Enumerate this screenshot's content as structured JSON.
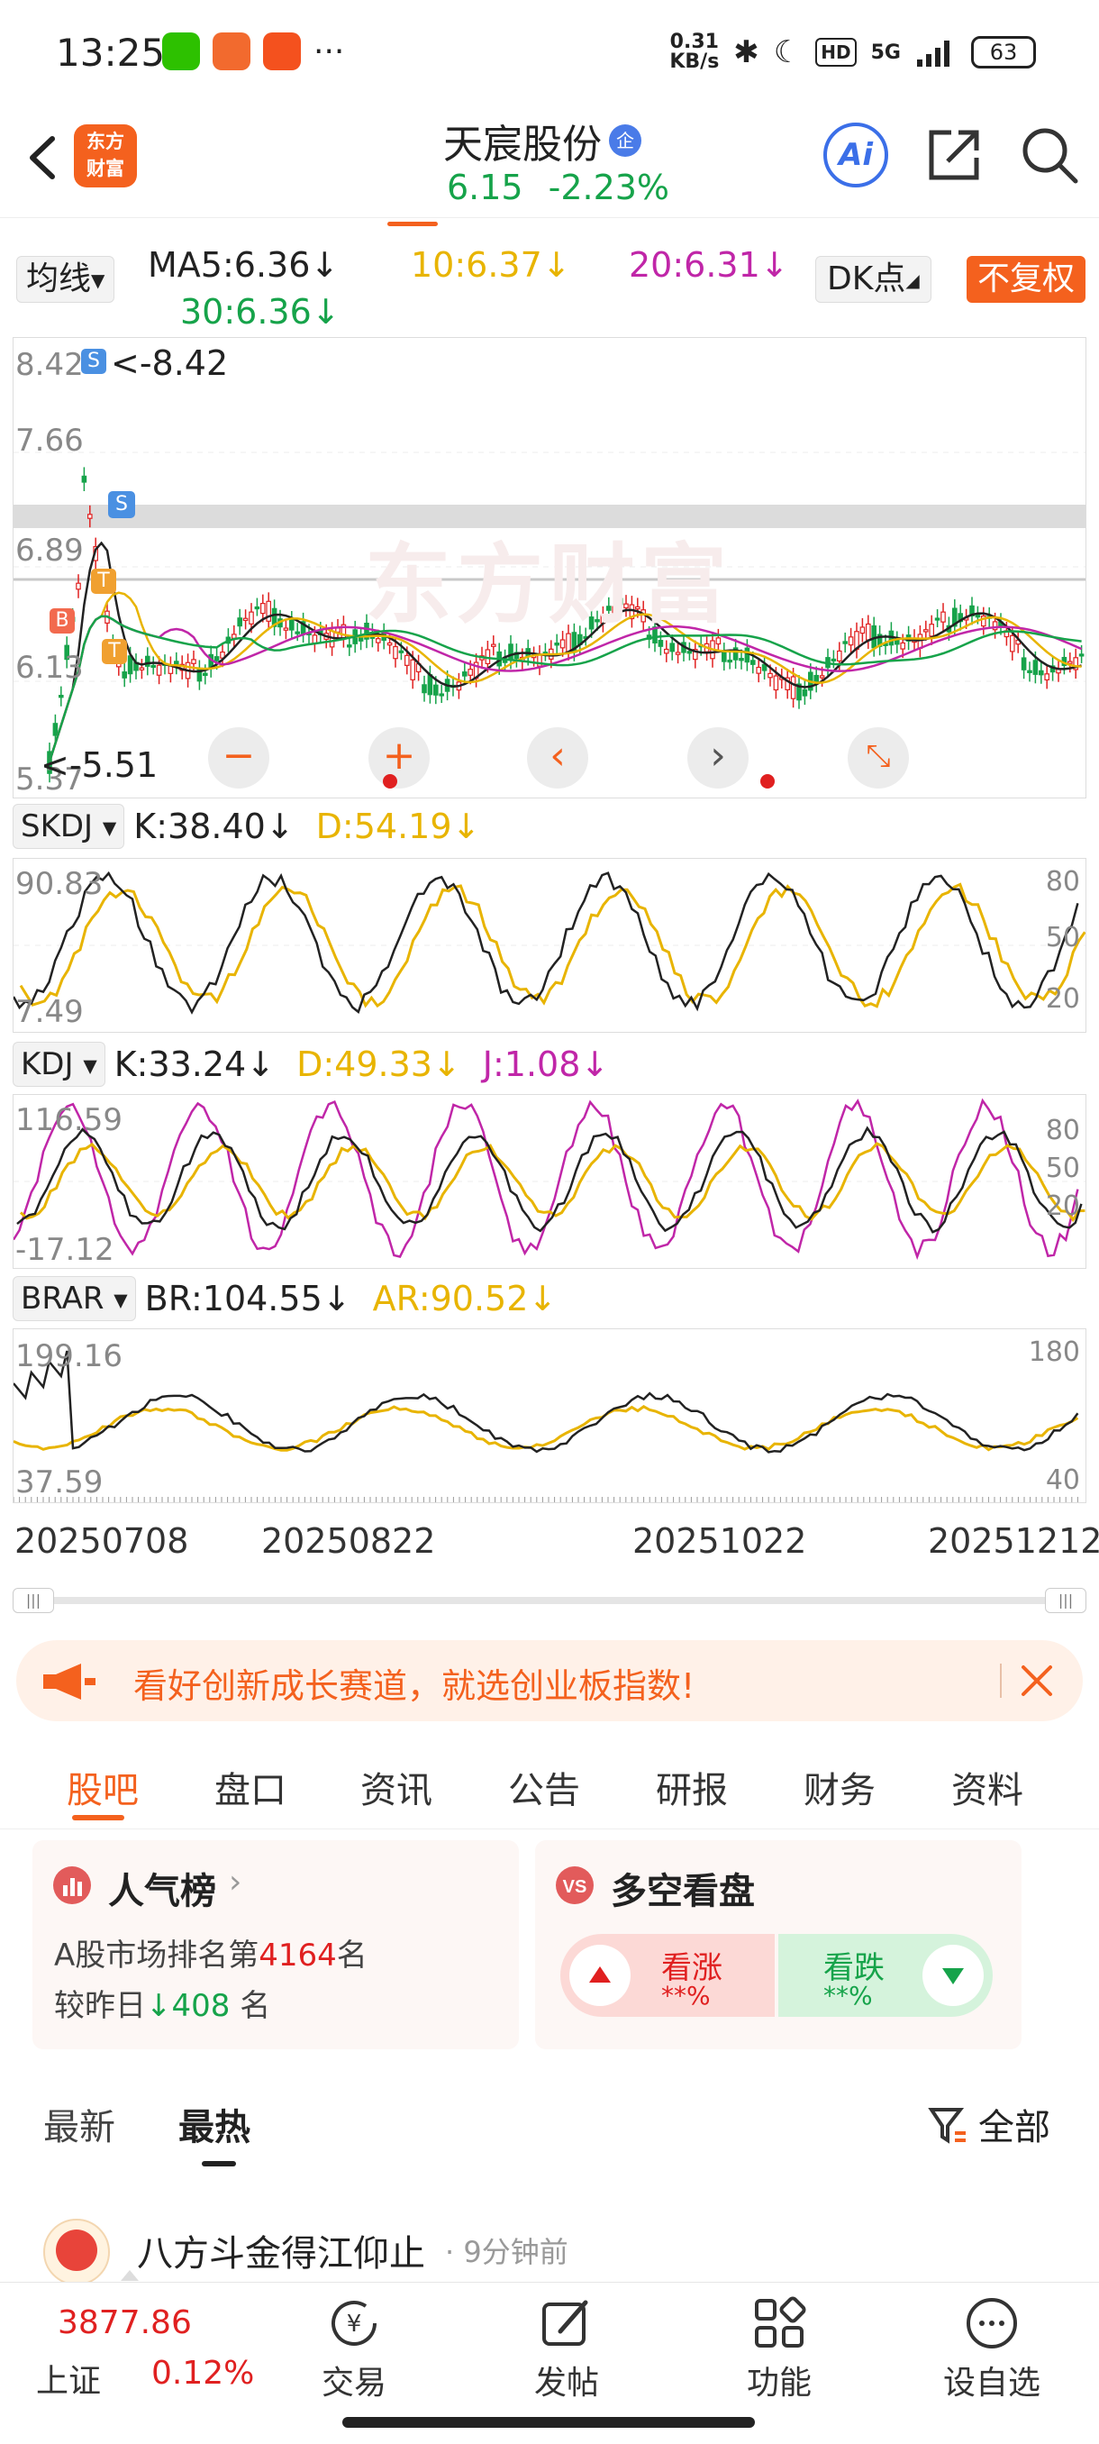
{
  "status_bar": {
    "time": "13:25",
    "net_speed_top": "0.31",
    "net_speed_bottom": "KB/s",
    "signal": "5G",
    "battery": "63"
  },
  "header": {
    "logo_line1": "东方",
    "logo_line2": "财富",
    "title": "天宸股份",
    "badge": "企",
    "price": "6.15",
    "change_pct": "-2.23%",
    "ai_label": "Ai"
  },
  "ma_bar": {
    "selector": "均线",
    "ma5": "MA5:6.36↓",
    "ma10": "10:6.37↓",
    "ma20": "20:6.31↓",
    "ma30": "30:6.36↓",
    "dk": "DK点",
    "adjust": "不复权"
  },
  "main_chart": {
    "y_labels": [
      "8.42",
      "7.66",
      "6.89",
      "6.13",
      "5.37"
    ],
    "high_marker": "<-8.42",
    "low_marker": "<-5.51",
    "watermark": "东方财富",
    "markers": {
      "s1": "S",
      "s2": "S",
      "t1": "T",
      "t2": "T",
      "b": "B"
    }
  },
  "skdj": {
    "selector": "SKDJ",
    "k": "K:38.40↓",
    "d": "D:54.19↓",
    "y_top": "90.83",
    "y_bottom": "7.49",
    "r80": "80",
    "r50": "50",
    "r20": "20"
  },
  "kdj": {
    "selector": "KDJ",
    "k": "K:33.24↓",
    "d": "D:49.33↓",
    "j": "J:1.08↓",
    "y_top": "116.59",
    "y_bottom": "-17.12",
    "r80": "80",
    "r50": "50",
    "r20": "20"
  },
  "brar": {
    "selector": "BRAR",
    "br": "BR:104.55↓",
    "ar": "AR:90.52↓",
    "y_top": "199.16",
    "y_bottom": "37.59",
    "r180": "180",
    "r40": "40"
  },
  "dates": [
    "20250708",
    "20250822",
    "20251022",
    "20251212"
  ],
  "banner": {
    "text": "看好创新成长赛道，就选创业板指数!"
  },
  "tabs": [
    "股吧",
    "盘口",
    "资讯",
    "公告",
    "研报",
    "财务",
    "资料"
  ],
  "popularity": {
    "title": "人气榜",
    "rank_prefix": "A股市场排名第",
    "rank": "4164",
    "rank_suffix": "名",
    "delta_prefix": "较昨日",
    "delta": "408",
    "delta_suffix": " 名"
  },
  "bullbear": {
    "title": "多空看盘",
    "up_label": "看涨",
    "up_value": "**%",
    "down_label": "看跌",
    "down_value": "**%"
  },
  "sort": {
    "newest": "最新",
    "hottest": "最热",
    "filter": "全部"
  },
  "post": {
    "author": "八方斗金得江仰止",
    "time": "· 9分钟前"
  },
  "bottom": {
    "index_value": "3877.86",
    "index_name": "上证",
    "index_change": "0.12%",
    "trade": "交易",
    "post": "发帖",
    "functions": "功能",
    "watchlist": "设自选"
  },
  "colors": {
    "accent": "#f4611e",
    "up": "#e02020",
    "down": "#16a34a",
    "ma10": "#e8b400",
    "ma20": "#c026a8"
  }
}
